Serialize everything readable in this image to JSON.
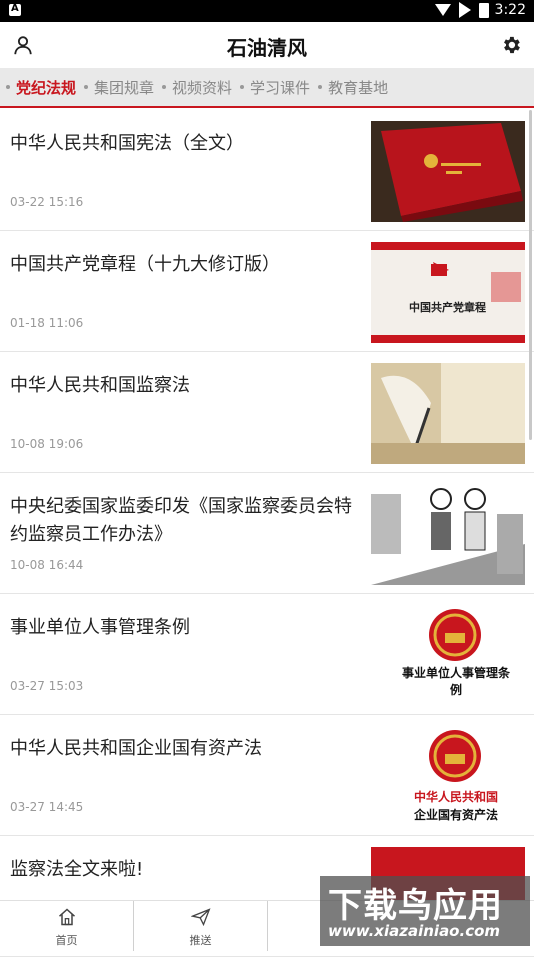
{
  "status": {
    "left_icon": "A",
    "time": "3:22"
  },
  "header": {
    "title": "石油清风",
    "user_icon": "user-icon",
    "settings_icon": "gear-icon"
  },
  "tabs": [
    {
      "label": "党纪法规",
      "active": true
    },
    {
      "label": "集团规章",
      "active": false
    },
    {
      "label": "视频资料",
      "active": false
    },
    {
      "label": "学习课件",
      "active": false
    },
    {
      "label": "教育基地",
      "active": false
    }
  ],
  "articles": [
    {
      "title": "中华人民共和国宪法（全文）",
      "date": "03-22 15:16"
    },
    {
      "title": "中国共产党章程（十九大修订版）",
      "date": "01-18 11:06",
      "thumb_text": "中国共产党章程"
    },
    {
      "title": "中华人民共和国监察法",
      "date": "10-08 19:06"
    },
    {
      "title": "中央纪委国家监委印发《国家监察委员会特约监察员工作办法》",
      "date": "10-08 16:44"
    },
    {
      "title": "事业单位人事管理条例",
      "date": "03-27 15:03",
      "thumb_text": "事业单位人事管理条例"
    },
    {
      "title": "中华人民共和国企业国有资产法",
      "date": "03-27 14:45",
      "thumb_text_red": "中华人民共和国",
      "thumb_text_black": "企业国有资产法"
    },
    {
      "title": "监察法全文来啦!",
      "date": ""
    }
  ],
  "bottom_nav": [
    {
      "label": "首页",
      "icon": "home-icon"
    },
    {
      "label": "推送",
      "icon": "send-icon"
    }
  ],
  "watermark": {
    "line1": "下载鸟应用",
    "line2": "www.xiazainiao.com"
  },
  "colors": {
    "accent": "#c8161e",
    "tab_bg": "#e9e9e9"
  }
}
